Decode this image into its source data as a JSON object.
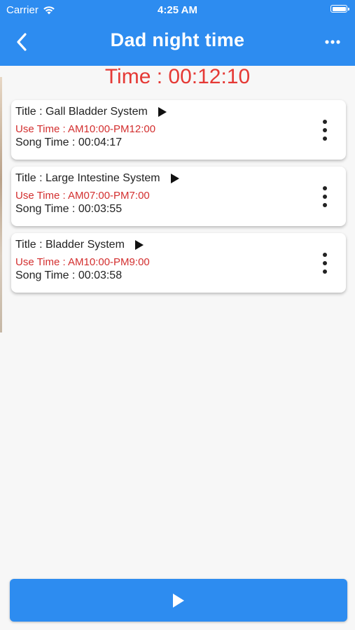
{
  "status_bar": {
    "carrier": "Carrier",
    "time": "4:25 AM"
  },
  "nav": {
    "title": "Dad night time",
    "back_icon": "chevron-left-icon",
    "more_icon": "more-horizontal-icon"
  },
  "total_time": "Time : 00:12:10",
  "songs": [
    {
      "title": "Title : Gall Bladder System",
      "use_time": "Use Time : AM10:00-PM12:00",
      "song_time": "Song Time : 00:04:17"
    },
    {
      "title": "Title : Large Intestine System",
      "use_time": "Use Time : AM07:00-PM7:00",
      "song_time": "Song Time : 00:03:55"
    },
    {
      "title": "Title : Bladder System",
      "use_time": "Use Time : AM10:00-PM9:00",
      "song_time": "Song Time : 00:03:58"
    }
  ],
  "colors": {
    "primary": "#2d8cf0",
    "accent_red": "#e53935",
    "use_time_red": "#d32f2f",
    "background": "#f7f7f7"
  },
  "footer": {
    "play_icon": "play-icon"
  }
}
